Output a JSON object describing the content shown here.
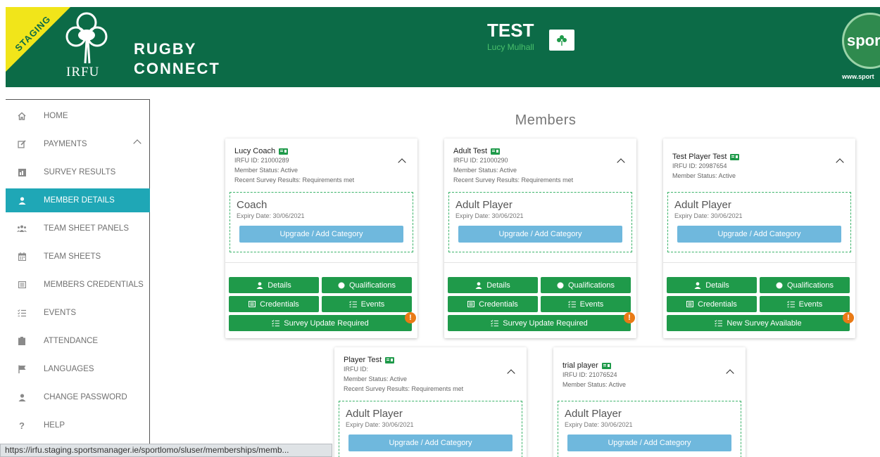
{
  "header": {
    "staging_label": "STAGING",
    "logo_text": "IRFU",
    "app_name_line1": "RUGBY",
    "app_name_line2": "CONNECT",
    "title": "TEST",
    "user_name": "Lucy Mulhall",
    "partner_logo_text": "sport",
    "partner_url": "www.sport"
  },
  "sidebar": {
    "items": [
      {
        "label": "HOME",
        "icon": "home-icon"
      },
      {
        "label": "PAYMENTS",
        "icon": "edit-icon"
      },
      {
        "label": "SURVEY RESULTS",
        "icon": "chart-icon"
      },
      {
        "label": "MEMBER DETAILS",
        "icon": "user-icon",
        "active": true
      },
      {
        "label": "TEAM SHEET PANELS",
        "icon": "users-icon"
      },
      {
        "label": "TEAM SHEETS",
        "icon": "calendar-icon"
      },
      {
        "label": "MEMBERS CREDENTIALS",
        "icon": "list-icon"
      },
      {
        "label": "EVENTS",
        "icon": "checklist-icon"
      },
      {
        "label": "ATTENDANCE",
        "icon": "clipboard-icon"
      },
      {
        "label": "LANGUAGES",
        "icon": "flag-icon"
      },
      {
        "label": "CHANGE PASSWORD",
        "icon": "user-icon"
      },
      {
        "label": "HELP",
        "icon": "question-icon"
      }
    ]
  },
  "status_bar": {
    "url": "https://irfu.staging.sportsmanager.ie/sportlomo/sluser/memberships/memb..."
  },
  "main": {
    "title": "Members"
  },
  "labels": {
    "upgrade": "Upgrade / Add Category",
    "details": "Details",
    "qualifications": "Qualifications",
    "credentials": "Credentials",
    "events": "Events",
    "alert_mark": "!"
  },
  "cards": [
    {
      "name": "Lucy Coach",
      "irfu_id": "IRFU ID: 21000289",
      "status": "Member Status: Active",
      "survey": "Recent Survey Results: Requirements met",
      "category": "Coach",
      "expiry": "Expiry Date: 30/06/2021",
      "survey_button": "Survey Update Required"
    },
    {
      "name": "Adult Test",
      "irfu_id": "IRFU ID: 21000290",
      "status": "Member Status: Active",
      "survey": "Recent Survey Results: Requirements met",
      "category": "Adult Player",
      "expiry": "Expiry Date: 30/06/2021",
      "survey_button": "Survey Update Required"
    },
    {
      "name": "Test Player Test",
      "irfu_id": "IRFU ID: 20987654",
      "status": "Member Status: Active",
      "category": "Adult Player",
      "expiry": "Expiry Date: 30/06/2021",
      "survey_button": "New Survey Available"
    },
    {
      "name": "Player Test",
      "irfu_id": "IRFU ID:",
      "status": "Member Status: Active",
      "survey": "Recent Survey Results: Requirements met",
      "category": "Adult Player",
      "expiry": "Expiry Date: 30/06/2021"
    },
    {
      "name": "trial player",
      "irfu_id": "IRFU ID: 21076524",
      "status": "Member Status: Active",
      "category": "Adult Player",
      "expiry": "Expiry Date: 30/06/2021"
    }
  ],
  "colors": {
    "header_green": "#0c6b47",
    "button_green": "#1f9a4a",
    "upgrade_blue": "#6fb8dd",
    "active_teal": "#1fa7b6",
    "staging_yellow": "#f1e51a",
    "alert_orange": "#e97a15"
  }
}
